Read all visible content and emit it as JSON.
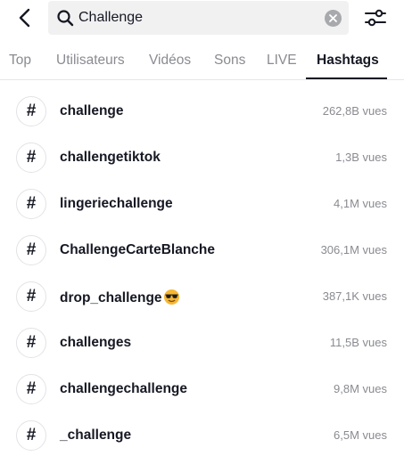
{
  "search": {
    "value": "Challenge",
    "placeholder": ""
  },
  "icons": {
    "back": "chevron-left-icon",
    "search": "search-icon",
    "clear": "clear-icon",
    "filter": "sliders-icon",
    "hashtag": "#"
  },
  "tabs": [
    {
      "label": "Top",
      "active": false
    },
    {
      "label": "Utilisateurs",
      "active": false
    },
    {
      "label": "Vidéos",
      "active": false
    },
    {
      "label": "Sons",
      "active": false
    },
    {
      "label": "LIVE",
      "active": false
    },
    {
      "label": "Hashtags",
      "active": true
    }
  ],
  "hashtags": [
    {
      "name": "challenge",
      "views": "262,8B vues"
    },
    {
      "name": "challengetiktok",
      "views": "1,3B vues"
    },
    {
      "name": "lingeriechallenge",
      "views": "4,1M vues"
    },
    {
      "name": "ChallengeCarteBlanche",
      "views": "306,1M vues"
    },
    {
      "name": "drop_challenge",
      "emoji": "sunglasses-face",
      "views": "387,1K vues"
    },
    {
      "name": "challenges",
      "views": "11,5B vues"
    },
    {
      "name": "challengechallenge",
      "views": "9,8M vues"
    },
    {
      "name": "_challenge",
      "views": "6,5M vues"
    }
  ],
  "colors": {
    "text": "#161823",
    "muted": "#8a8b91",
    "search_bg": "#f1f1f2",
    "emoji": "#f7b733"
  }
}
